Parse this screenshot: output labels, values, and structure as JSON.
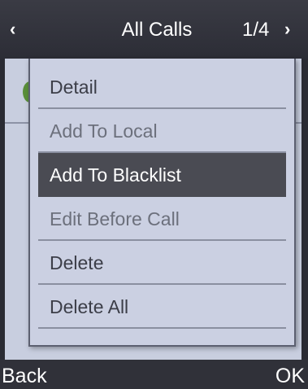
{
  "header": {
    "back_arrow": "‹",
    "title": "All Calls",
    "page_indicator": "1/4",
    "next_arrow": "›"
  },
  "menu": {
    "items": [
      {
        "label": "Detail",
        "state": "normal"
      },
      {
        "label": "Add To Local",
        "state": "dim"
      },
      {
        "label": "Add To Blacklist",
        "state": "selected"
      },
      {
        "label": "Edit Before Call",
        "state": "dim"
      },
      {
        "label": "Delete",
        "state": "normal"
      },
      {
        "label": "Delete All",
        "state": "normal"
      }
    ]
  },
  "softkeys": {
    "left": "Back",
    "right": "OK"
  },
  "colors": {
    "header_bg": "#2c2d36",
    "menu_bg": "#cbd0e2",
    "selected_bg": "#4a4b53",
    "text_dark": "#3c3e48",
    "text_light": "#ffffff"
  }
}
